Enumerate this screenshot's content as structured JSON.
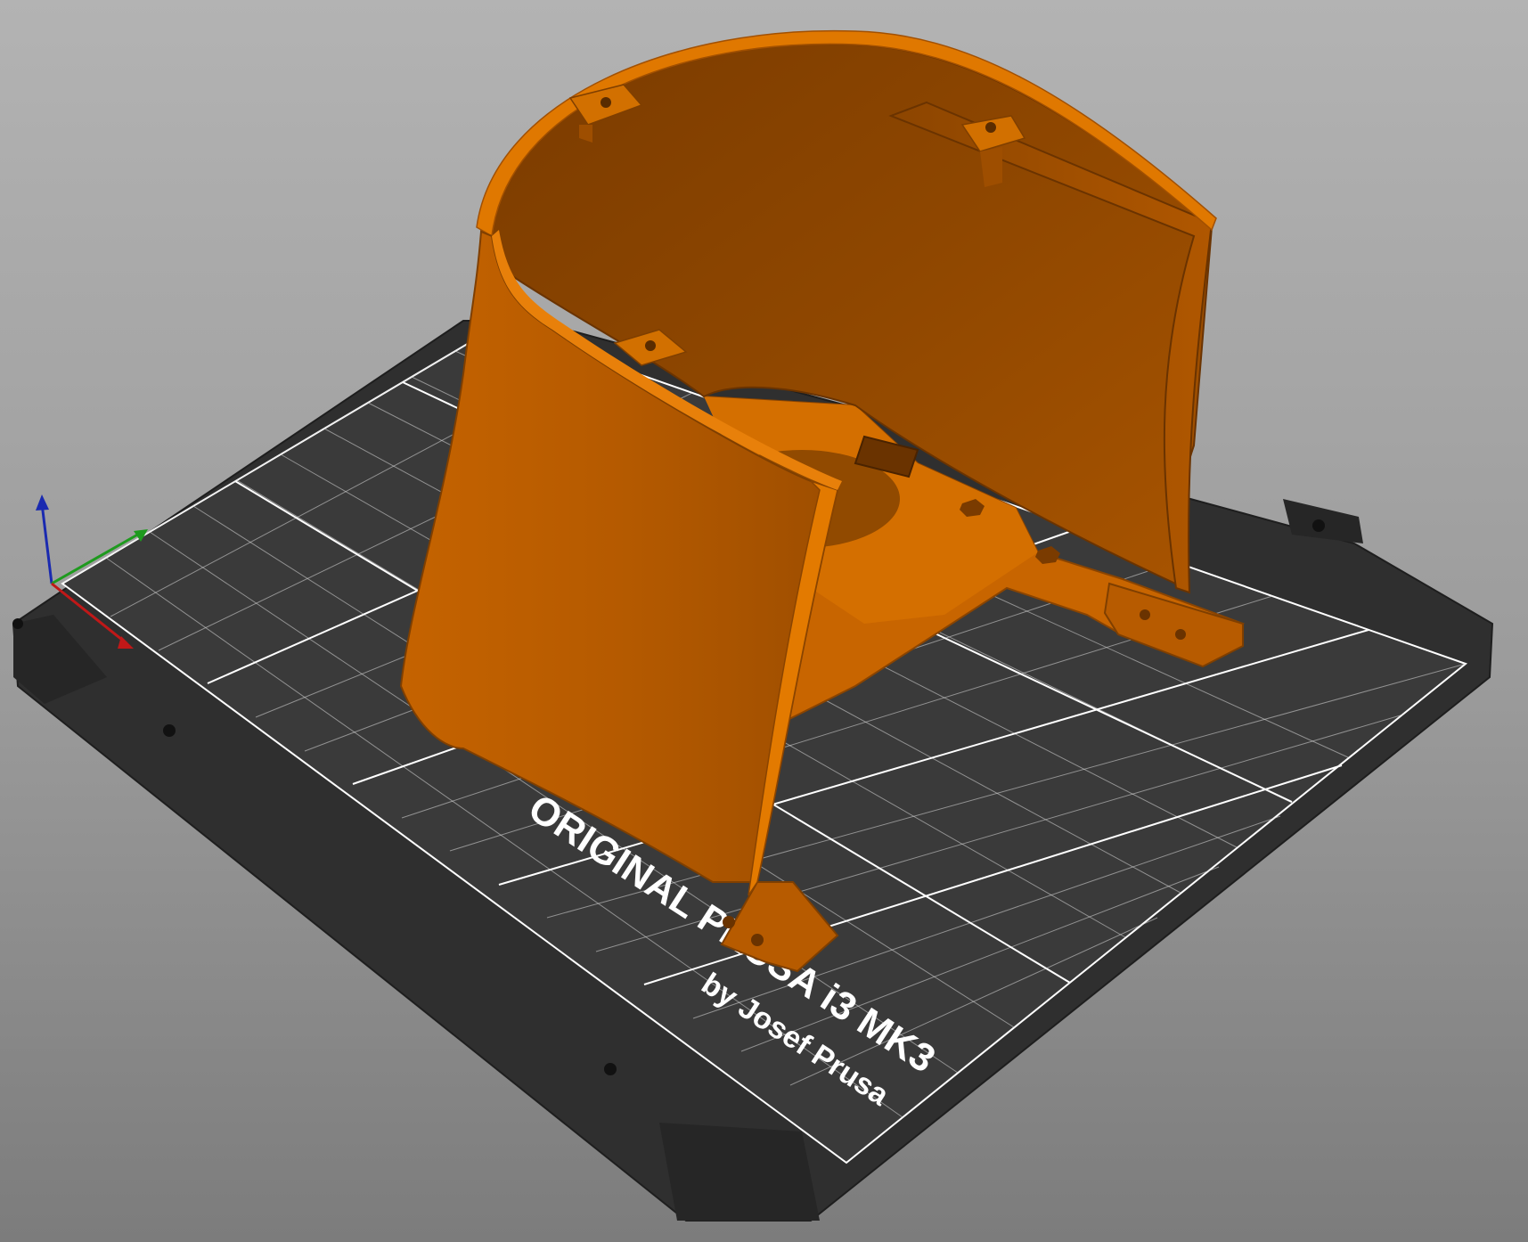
{
  "viewport": {
    "background_top": "#b3b3b3",
    "background_bottom": "#7c7c7c"
  },
  "bed": {
    "model_line": "ORIGINAL PRUSA i3  MK3",
    "byline": "by Josef Prusa",
    "plate_color": "#2e2e2e",
    "grid_color": "#ffffff"
  },
  "model": {
    "color": "#d26a00",
    "shadow_color": "#8a4400"
  },
  "axes": {
    "x_color": "#c01818",
    "y_color": "#1e9a1e",
    "z_color": "#1a2ab0"
  }
}
